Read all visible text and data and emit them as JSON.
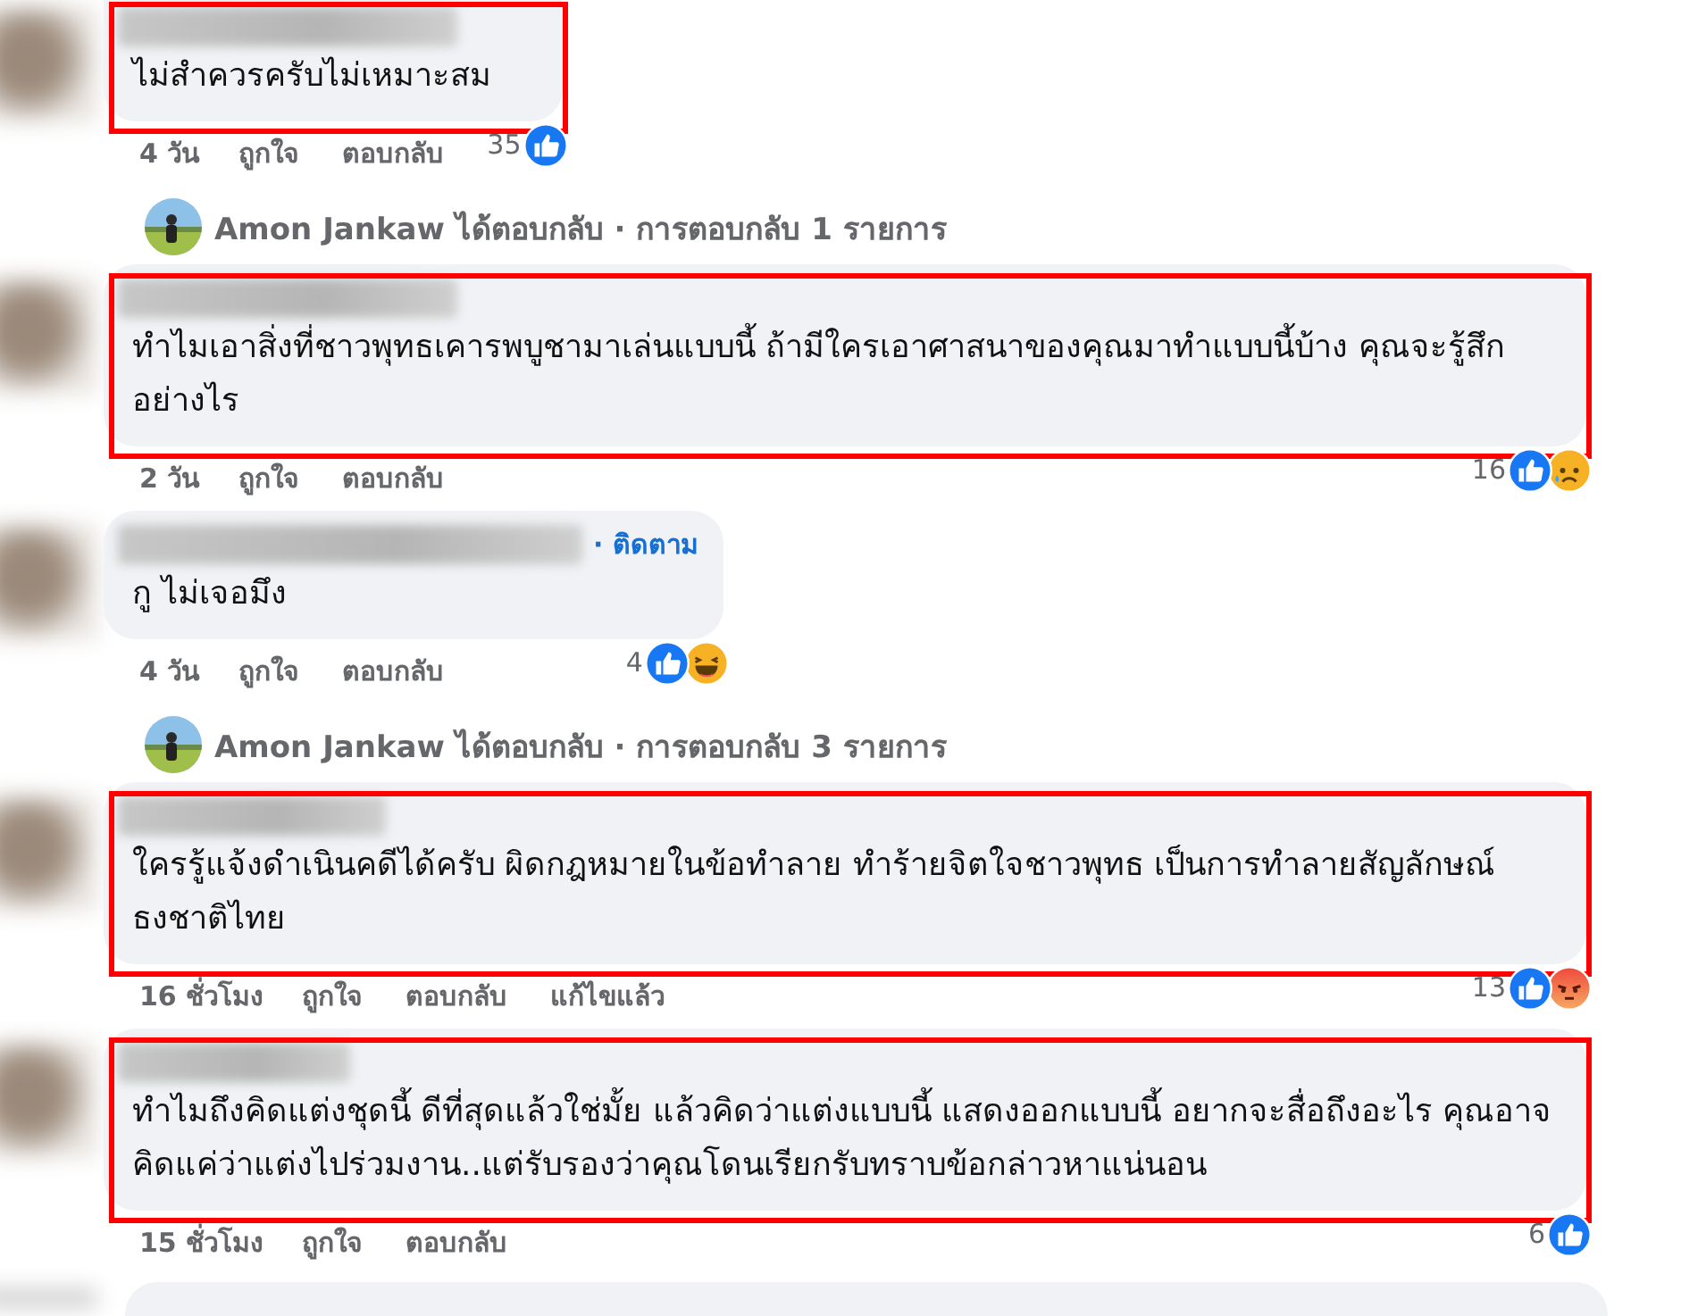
{
  "comments": [
    {
      "kind": "comment",
      "highlighted": true,
      "text": "ไม่สำควรครับไม่เหมาะสม",
      "time": "4 วัน",
      "like": "ถูกใจ",
      "reply": "ตอบกลับ",
      "count": "35",
      "reactions": [
        {
          "kind": "like"
        }
      ]
    },
    {
      "kind": "replies",
      "text": "Amon Jankaw ได้ตอบกลับ · การตอบกลับ 1 รายการ"
    },
    {
      "kind": "comment",
      "highlighted": true,
      "text": "ทำไมเอาสิ่งที่ชาวพุทธเคารพบูชามาเล่นแบบนี้ ถ้ามีใครเอาศาสนาของคุณมาทำแบบนี้บ้าง คุณจะรู้สึกอย่างไร",
      "time": "2 วัน",
      "like": "ถูกใจ",
      "reply": "ตอบกลับ",
      "count": "16",
      "reactions": [
        {
          "kind": "like"
        },
        {
          "kind": "sad"
        }
      ]
    },
    {
      "kind": "comment",
      "highlighted": false,
      "follow": "· ติดตาม",
      "text": "กู ไม่เจอมึง",
      "time": "4 วัน",
      "like": "ถูกใจ",
      "reply": "ตอบกลับ",
      "count": "4",
      "reactions": [
        {
          "kind": "like"
        },
        {
          "kind": "haha"
        }
      ]
    },
    {
      "kind": "replies",
      "text": "Amon Jankaw ได้ตอบกลับ · การตอบกลับ 3 รายการ"
    },
    {
      "kind": "comment",
      "highlighted": true,
      "text": "ใครรู้แจ้งดำเนินคดีได้ครับ ผิดกฎหมายในข้อทำลาย ทำร้ายจิตใจชาวพุทธ เป็นการทำลายสัญลักษณ์ธงชาติไทย",
      "time": "16 ชั่วโมง",
      "like": "ถูกใจ",
      "reply": "ตอบกลับ",
      "edited": "แก้ไขแล้ว",
      "count": "13",
      "reactions": [
        {
          "kind": "like"
        },
        {
          "kind": "angry"
        }
      ]
    },
    {
      "kind": "comment",
      "highlighted": true,
      "text": "ทำไมถึงคิดแต่งชุดนี้ ดีที่สุดแล้วใช่มั้ย แล้วคิดว่าแต่งแบบนี้ แสดงออกแบบนี้ อยากจะสื่อถึงอะไร คุณอาจคิดแค่ว่าแต่งไปร่วมงาน..แต่รับรองว่าคุณโดนเรียกรับทราบข้อกล่าวหาแน่นอน",
      "time": "15 ชั่วโมง",
      "like": "ถูกใจ",
      "reply": "ตอบกลับ",
      "count": "6",
      "reactions": [
        {
          "kind": "like"
        }
      ]
    }
  ]
}
